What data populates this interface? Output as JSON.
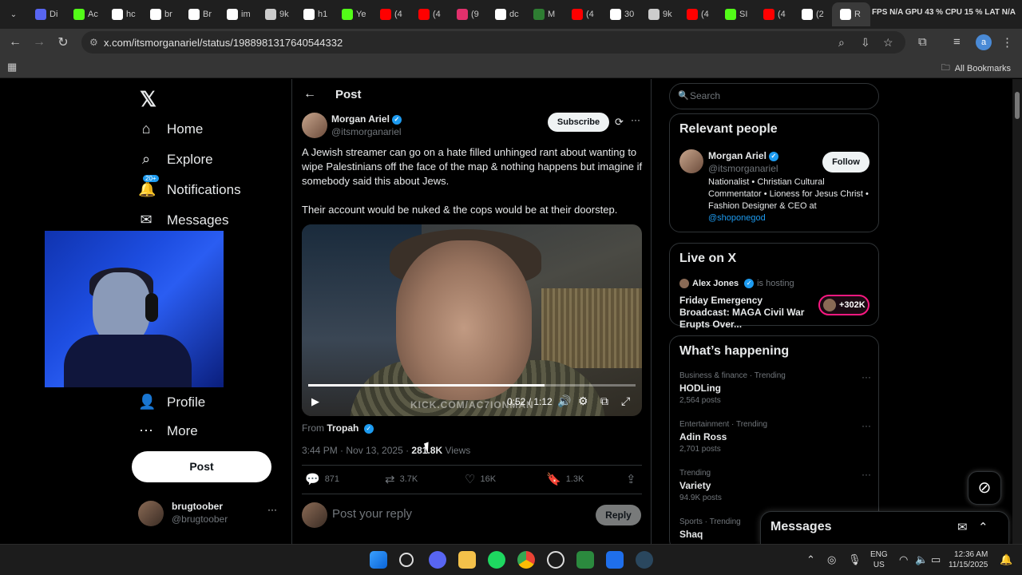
{
  "browser": {
    "tabs": [
      {
        "label": "Di",
        "color": "#5865f2"
      },
      {
        "label": "Ac",
        "color": "#53fc18"
      },
      {
        "label": "hc",
        "color": "#ffffff"
      },
      {
        "label": "br",
        "color": "#ffffff"
      },
      {
        "label": "Br",
        "color": "#ffffff"
      },
      {
        "label": "im",
        "color": "#ffffff"
      },
      {
        "label": "9k",
        "color": "#cccccc"
      },
      {
        "label": "h1",
        "color": "#ffffff"
      },
      {
        "label": "Ye",
        "color": "#53fc18"
      },
      {
        "label": "(4",
        "color": "#ff0000"
      },
      {
        "label": "(4",
        "color": "#ff0000"
      },
      {
        "label": "(9",
        "color": "#e1306c"
      },
      {
        "label": "dc",
        "color": "#ffffff"
      },
      {
        "label": "M",
        "color": "#2e7d32"
      },
      {
        "label": "(4",
        "color": "#ff0000"
      },
      {
        "label": "30",
        "color": "#ffffff"
      },
      {
        "label": "9k",
        "color": "#cccccc"
      },
      {
        "label": "(4",
        "color": "#ff0000"
      },
      {
        "label": "SI",
        "color": "#53fc18"
      },
      {
        "label": "(4",
        "color": "#ff0000"
      },
      {
        "label": "(2",
        "color": "#ffffff"
      },
      {
        "label": "R",
        "color": "#ffffff",
        "active": true
      }
    ],
    "system_stats": "FPS N/A   GPU 43 %   CPU 15 %   LAT N/A",
    "url": "x.com/itsmorganariel/status/1988981317640544332",
    "all_bookmarks": "All Bookmarks"
  },
  "nav": {
    "items": [
      {
        "label": "Home",
        "icon": "home-icon"
      },
      {
        "label": "Explore",
        "icon": "search-icon"
      },
      {
        "label": "Notifications",
        "icon": "bell-icon"
      },
      {
        "label": "Messages",
        "icon": "envelope-icon"
      },
      {
        "label": "s",
        "icon": "hidden"
      },
      {
        "label": "ties",
        "icon": "hidden"
      },
      {
        "label": "Profile",
        "icon": "person-icon"
      },
      {
        "label": "More",
        "icon": "more-circle-icon"
      }
    ],
    "notif_badge": "20+",
    "post_button": "Post",
    "me": {
      "name": "brugtoober",
      "handle": "@brugtoober",
      "more": "···"
    }
  },
  "post": {
    "header_title": "Post",
    "author_name": "Morgan Ariel",
    "author_handle": "@itsmorganariel",
    "subscribe_label": "Subscribe",
    "text_p1": "A Jewish streamer can go on a hate filled unhinged rant about wanting to wipe Palestinians off the face of the map & nothing happens but imagine if somebody said this about Jews.",
    "text_p2": "Their account would be nuked & the cops would be at their doorstep.",
    "video": {
      "watermark": "KICK.COM/AC7IONMAN",
      "time": "0:52 / 1:12",
      "progress": 0.722
    },
    "from_prefix": "From",
    "from_name": "Tropah",
    "time": "3:44 PM · Nov 13, 2025 ·",
    "views_count": "281.8K",
    "views_label": "Views",
    "replies": "871",
    "reposts": "3.7K",
    "likes": "16K",
    "bookmarks": "1.3K",
    "reply_placeholder": "Post your reply",
    "reply_button": "Reply"
  },
  "sidebar": {
    "search_placeholder": "Search",
    "relevant": {
      "title": "Relevant people",
      "name": "Morgan Ariel",
      "handle": "@itsmorganariel",
      "follow": "Follow",
      "bio": "Nationalist • Christian Cultural Commentator • Lioness for Jesus Christ • Fashion Designer & CEO at",
      "bio_link": "@shoponegod"
    },
    "live": {
      "title": "Live on X",
      "host": "Alex Jones",
      "host_suffix": "is hosting",
      "stream_title": "Friday Emergency Broadcast: MAGA Civil War Erupts Over...",
      "count": "+302K"
    },
    "happening": {
      "title": "What’s happening",
      "trends": [
        {
          "category": "Business & finance · Trending",
          "name": "HODLing",
          "posts": "2,564 posts"
        },
        {
          "category": "Entertainment · Trending",
          "name": "Adin Ross",
          "posts": "2,701 posts"
        },
        {
          "category": "Trending",
          "name": "Variety",
          "posts": "94.9K posts"
        },
        {
          "category": "Sports · Trending",
          "name": "Shaq",
          "posts": ""
        }
      ]
    }
  },
  "messages_drawer": {
    "title": "Messages"
  },
  "taskbar": {
    "lang": "ENG",
    "region": "US",
    "time": "12:36 AM",
    "date": "11/15/2025"
  }
}
